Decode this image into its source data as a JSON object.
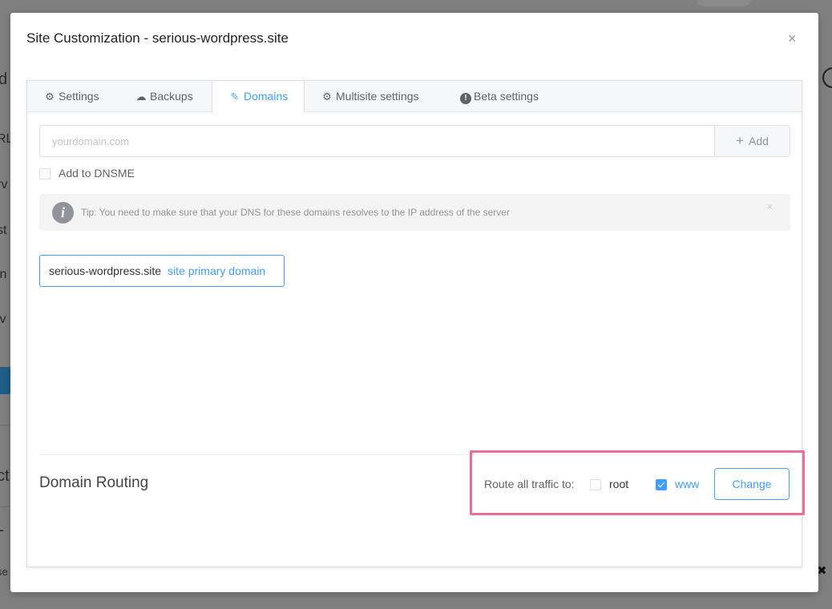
{
  "background": {
    "fragments": [
      "d",
      "RL",
      "rv",
      "st",
      "in",
      "lv",
      "ct",
      "L",
      "se"
    ]
  },
  "modal": {
    "title": "Site Customization - serious-wordpress.site",
    "close_glyph": "×"
  },
  "tabs": [
    {
      "label": "Settings",
      "icon": "gear-icon",
      "glyph": "⚙"
    },
    {
      "label": "Backups",
      "icon": "cloud-upload-icon",
      "glyph": "☁"
    },
    {
      "label": "Domains",
      "icon": "edit-icon",
      "glyph": "✎"
    },
    {
      "label": "Multisite settings",
      "icon": "gear-icon",
      "glyph": "⚙"
    },
    {
      "label": "Beta settings",
      "icon": "exclamation-circle-icon",
      "glyph": "!"
    }
  ],
  "active_tab": "Domains",
  "domain_form": {
    "input_placeholder": "yourdomain.com",
    "input_value": "",
    "add_button": "Add",
    "add_icon": "+",
    "dnsme_label": "Add to DNSME",
    "dnsme_checked": false
  },
  "tip": {
    "icon": "info-icon",
    "glyph": "i",
    "text": "Tip: You need to make sure that your DNS for these domains resolves to the IP address of the server",
    "close_glyph": "×"
  },
  "domains": [
    {
      "name": "serious-wordpress.site",
      "badge": "site primary domain"
    }
  ],
  "routing": {
    "title": "Domain Routing",
    "route_label": "Route all traffic to:",
    "options": [
      {
        "label": "root",
        "checked": false
      },
      {
        "label": "www",
        "checked": true
      }
    ],
    "change_button": "Change"
  },
  "colors": {
    "accent": "#409eff",
    "highlight": "#ec6d9b"
  }
}
